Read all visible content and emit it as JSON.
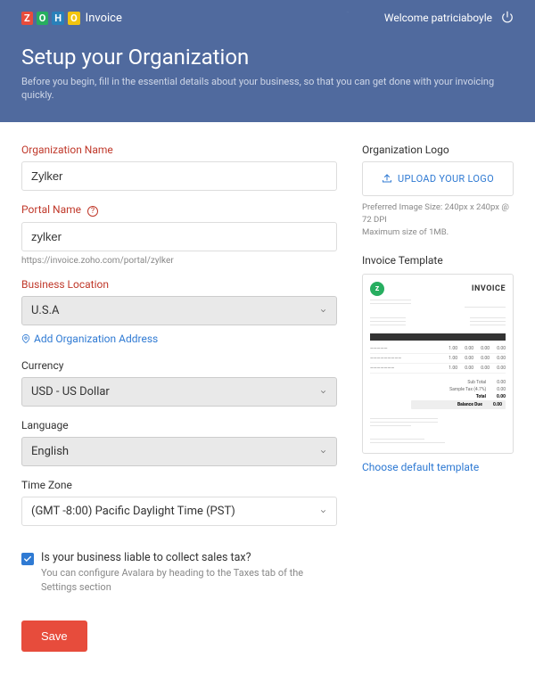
{
  "brand": {
    "product": "Invoice"
  },
  "topbar": {
    "welcome": "Welcome patriciaboyle"
  },
  "header": {
    "title": "Setup your Organization",
    "subtitle": "Before you begin, fill in the essential details about your business, so that you can get done with your invoicing quickly."
  },
  "form": {
    "orgName": {
      "label": "Organization Name",
      "value": "Zylker"
    },
    "portalName": {
      "label": "Portal Name",
      "value": "zylker",
      "url": "https://invoice.zoho.com/portal/zylker"
    },
    "location": {
      "label": "Business Location",
      "value": "U.S.A",
      "addLink": "Add Organization Address"
    },
    "currency": {
      "label": "Currency",
      "value": "USD - US Dollar"
    },
    "language": {
      "label": "Language",
      "value": "English"
    },
    "timezone": {
      "label": "Time Zone",
      "value": "(GMT -8:00) Pacific Daylight Time (PST)"
    },
    "tax": {
      "question": "Is your business liable to collect sales tax?",
      "sub": "You can configure Avalara by heading to the Taxes tab of the Settings section",
      "checked": true
    },
    "saveLabel": "Save"
  },
  "side": {
    "logoLabel": "Organization Logo",
    "uploadLabel": "UPLOAD YOUR LOGO",
    "logoHint1": "Preferred Image Size: 240px x 240px @ 72 DPI",
    "logoHint2": "Maximum size of 1MB.",
    "templateLabel": "Invoice Template",
    "templateTitle": "INVOICE",
    "chooseLink": "Choose default template"
  }
}
